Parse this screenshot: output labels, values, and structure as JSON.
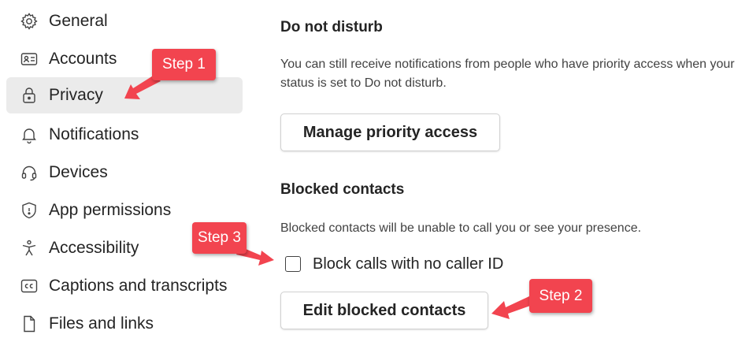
{
  "sidebar": {
    "items": [
      {
        "label": "General",
        "icon": "gear-icon"
      },
      {
        "label": "Accounts",
        "icon": "id-card-icon"
      },
      {
        "label": "Privacy",
        "icon": "lock-icon",
        "selected": true
      },
      {
        "label": "Notifications",
        "icon": "bell-icon"
      },
      {
        "label": "Devices",
        "icon": "headset-icon"
      },
      {
        "label": "App permissions",
        "icon": "shield-icon"
      },
      {
        "label": "Accessibility",
        "icon": "accessibility-icon"
      },
      {
        "label": "Captions and transcripts",
        "icon": "cc-icon"
      },
      {
        "label": "Files and links",
        "icon": "document-icon"
      }
    ]
  },
  "main": {
    "dnd": {
      "title": "Do not disturb",
      "description": "You can still receive notifications from people who have priority access when your status is set to Do not disturb.",
      "button": "Manage priority access"
    },
    "blocked": {
      "title": "Blocked contacts",
      "description": "Blocked contacts will be unable to call you or see your presence.",
      "checkbox_label": "Block calls with no caller ID",
      "checkbox_checked": false,
      "button": "Edit blocked contacts"
    }
  },
  "annotations": {
    "step1": "Step 1",
    "step2": "Step 2",
    "step3": "Step 3",
    "color": "#f2444f"
  }
}
